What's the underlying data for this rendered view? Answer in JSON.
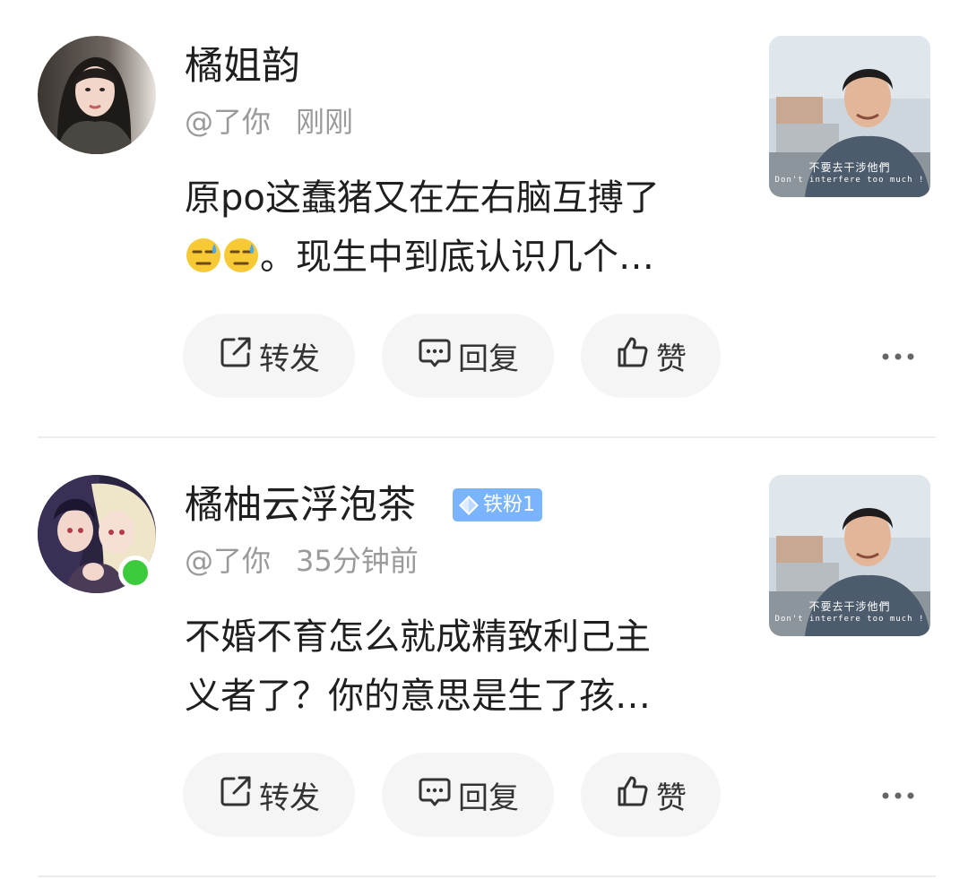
{
  "comments": [
    {
      "username": "橘姐韵",
      "handle": "@了你",
      "time": "刚刚",
      "badge": "",
      "line1": "原po这蠢猪又在左右脑互搏了",
      "line2": "。现生中到底认识几个…",
      "thumb_caption_cn": "不要去干涉他們",
      "thumb_caption_en": "Don't interfere too much !",
      "actions": {
        "share": "转发",
        "reply": "回复",
        "like": "赞"
      }
    },
    {
      "username": "橘柚云浮泡茶",
      "handle": "@了你",
      "time": "35分钟前",
      "badge": "铁粉1",
      "line1": "不婚不育怎么就成精致利己主",
      "line2": "义者了？你的意思是生了孩…",
      "thumb_caption_cn": "不要去干涉他們",
      "thumb_caption_en": "Don't interfere too much !",
      "actions": {
        "share": "转发",
        "reply": "回复",
        "like": "赞"
      }
    }
  ],
  "colors": {
    "online": "#3ccb3c",
    "badge": "#7ab4ff",
    "meta_text": "#9a9a9a",
    "button_bg": "#f5f5f5"
  },
  "icons": {
    "share": "share-icon",
    "reply": "comment-icon",
    "like": "thumbs-up-icon",
    "more": "more-dots-icon",
    "emoji": "sweat-emoji-icon",
    "badge": "diamond-icon"
  }
}
